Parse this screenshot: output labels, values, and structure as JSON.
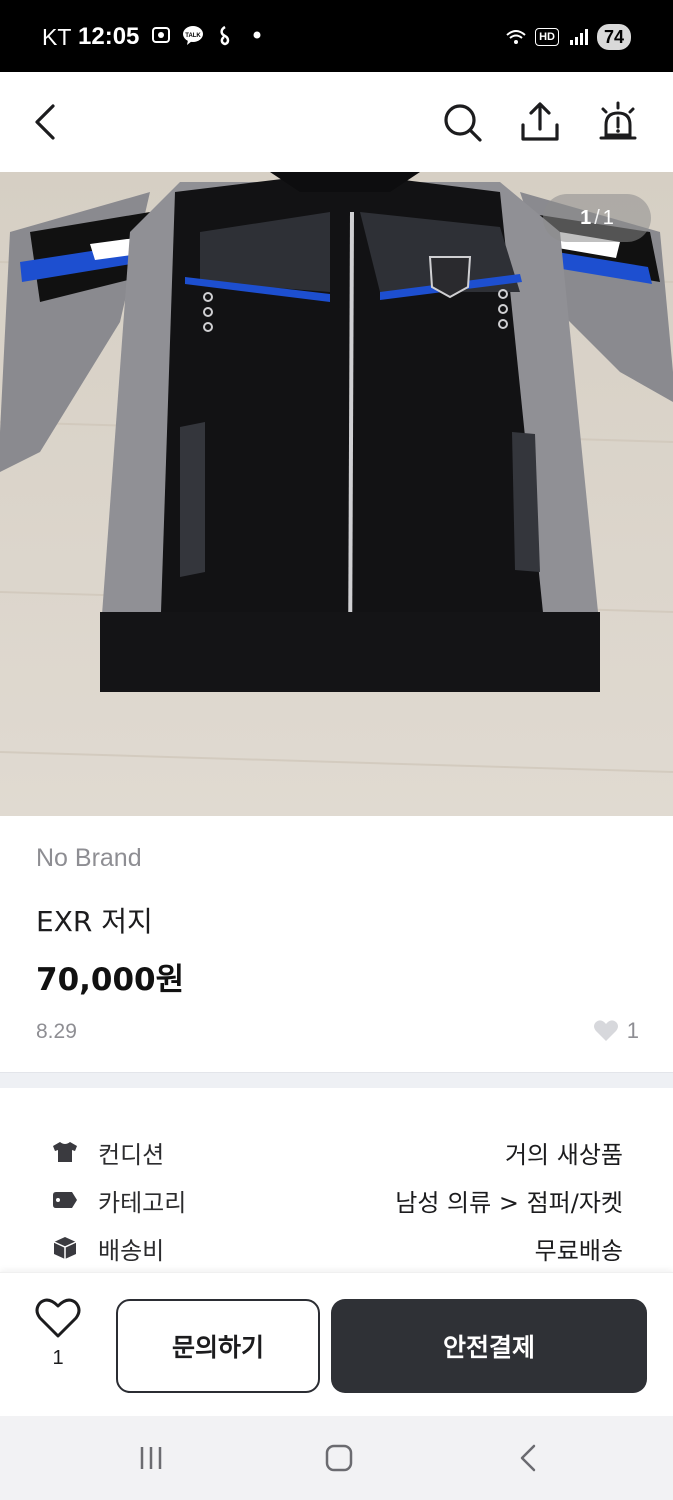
{
  "status_bar": {
    "carrier": "KT",
    "time": "12:05",
    "hd_label": "HD",
    "battery": "74"
  },
  "nav": {
    "back_icon": "back-chevron-icon",
    "search_icon": "search-icon",
    "share_icon": "share-icon",
    "alert_icon": "report-siren-icon"
  },
  "photo": {
    "counter_current": "1",
    "counter_separator": "/",
    "counter_total": "1"
  },
  "product": {
    "brand": "No Brand",
    "title": "EXR 저지",
    "price": "70,000원",
    "date": "8.29",
    "likes": "1"
  },
  "specs": [
    {
      "icon": "tshirt-icon",
      "label": "컨디션",
      "value": "거의 새상품"
    },
    {
      "icon": "tag-icon",
      "label": "카테고리",
      "value": "남성 의류 > 점퍼/자켓"
    },
    {
      "icon": "box-icon",
      "label": "배송비",
      "value": "무료배송"
    }
  ],
  "bottom_bar": {
    "like_count": "1",
    "inquiry_label": "문의하기",
    "pay_label": "안전결제"
  },
  "colors": {
    "primary_dark": "#2f3136",
    "muted_text": "#8e8e93",
    "divider": "#eef0f4"
  }
}
